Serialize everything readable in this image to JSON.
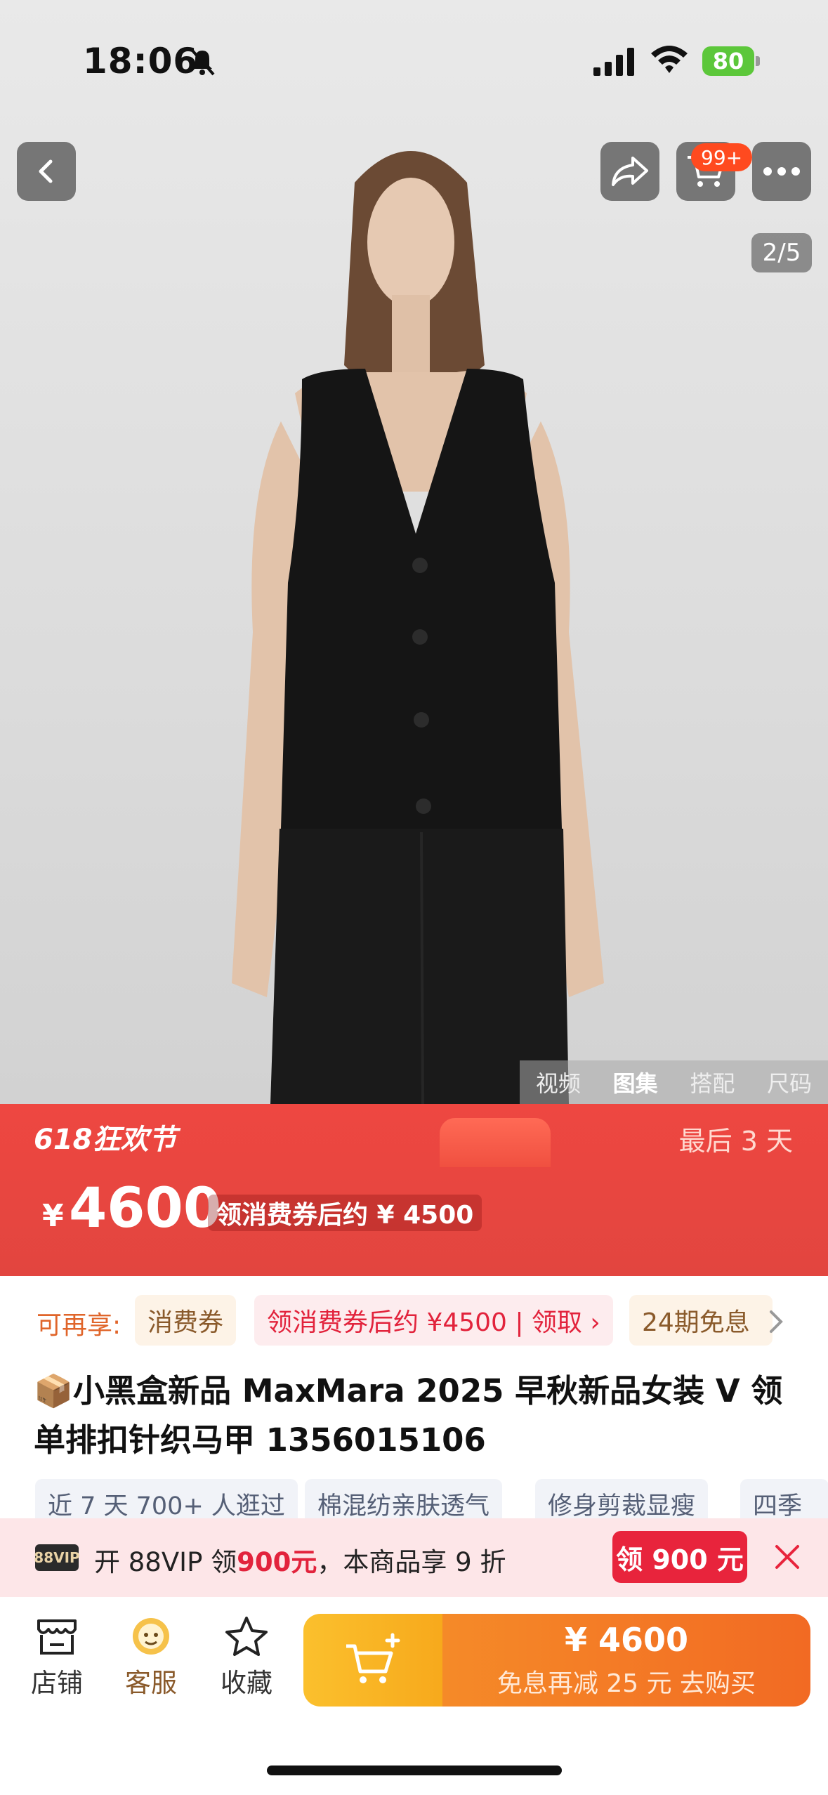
{
  "status": {
    "time": "18:06",
    "battery": "80"
  },
  "gallery": {
    "counter": "2/5",
    "cart_badge": "99+",
    "tabs": [
      "视频",
      "图集",
      "搭配",
      "尺码"
    ],
    "active_tab": "图集"
  },
  "promo": {
    "festival": "618狂欢节",
    "days_left": "最后 3 天",
    "currency": "¥",
    "price": "4600",
    "after_coupon": "领消费券后约 ¥ 4500"
  },
  "perks": {
    "label": "可再享:",
    "chips": [
      "消费券",
      "领消费券后约 ¥4500 | 领取 ›",
      "24期免息"
    ]
  },
  "product": {
    "title": "📦小黑盒新品 MaxMara 2025 早秋新品女装 V 领单排扣针织马甲 1356015106",
    "tags": [
      "近 7 天 700+ 人逛过",
      "棉混纺亲肤透气",
      "修身剪裁显瘦",
      "四季"
    ]
  },
  "vip": {
    "badge": "88VIP",
    "text_prefix": "开 88VIP 领",
    "amount": "900元",
    "text_suffix": "，本商品享 9 折",
    "button": "领 900 元"
  },
  "bottom": {
    "tabs": [
      {
        "label": "店铺",
        "icon": "store-icon"
      },
      {
        "label": "客服",
        "icon": "customer-service-icon"
      },
      {
        "label": "收藏",
        "icon": "star-icon"
      }
    ],
    "buy_price": "¥ 4600",
    "buy_sub": "免息再减 25 元  去购买"
  },
  "colors": {
    "promo_red": "#e2453f",
    "accent_orange": "#f26a23",
    "vip_red": "#e8243c"
  }
}
